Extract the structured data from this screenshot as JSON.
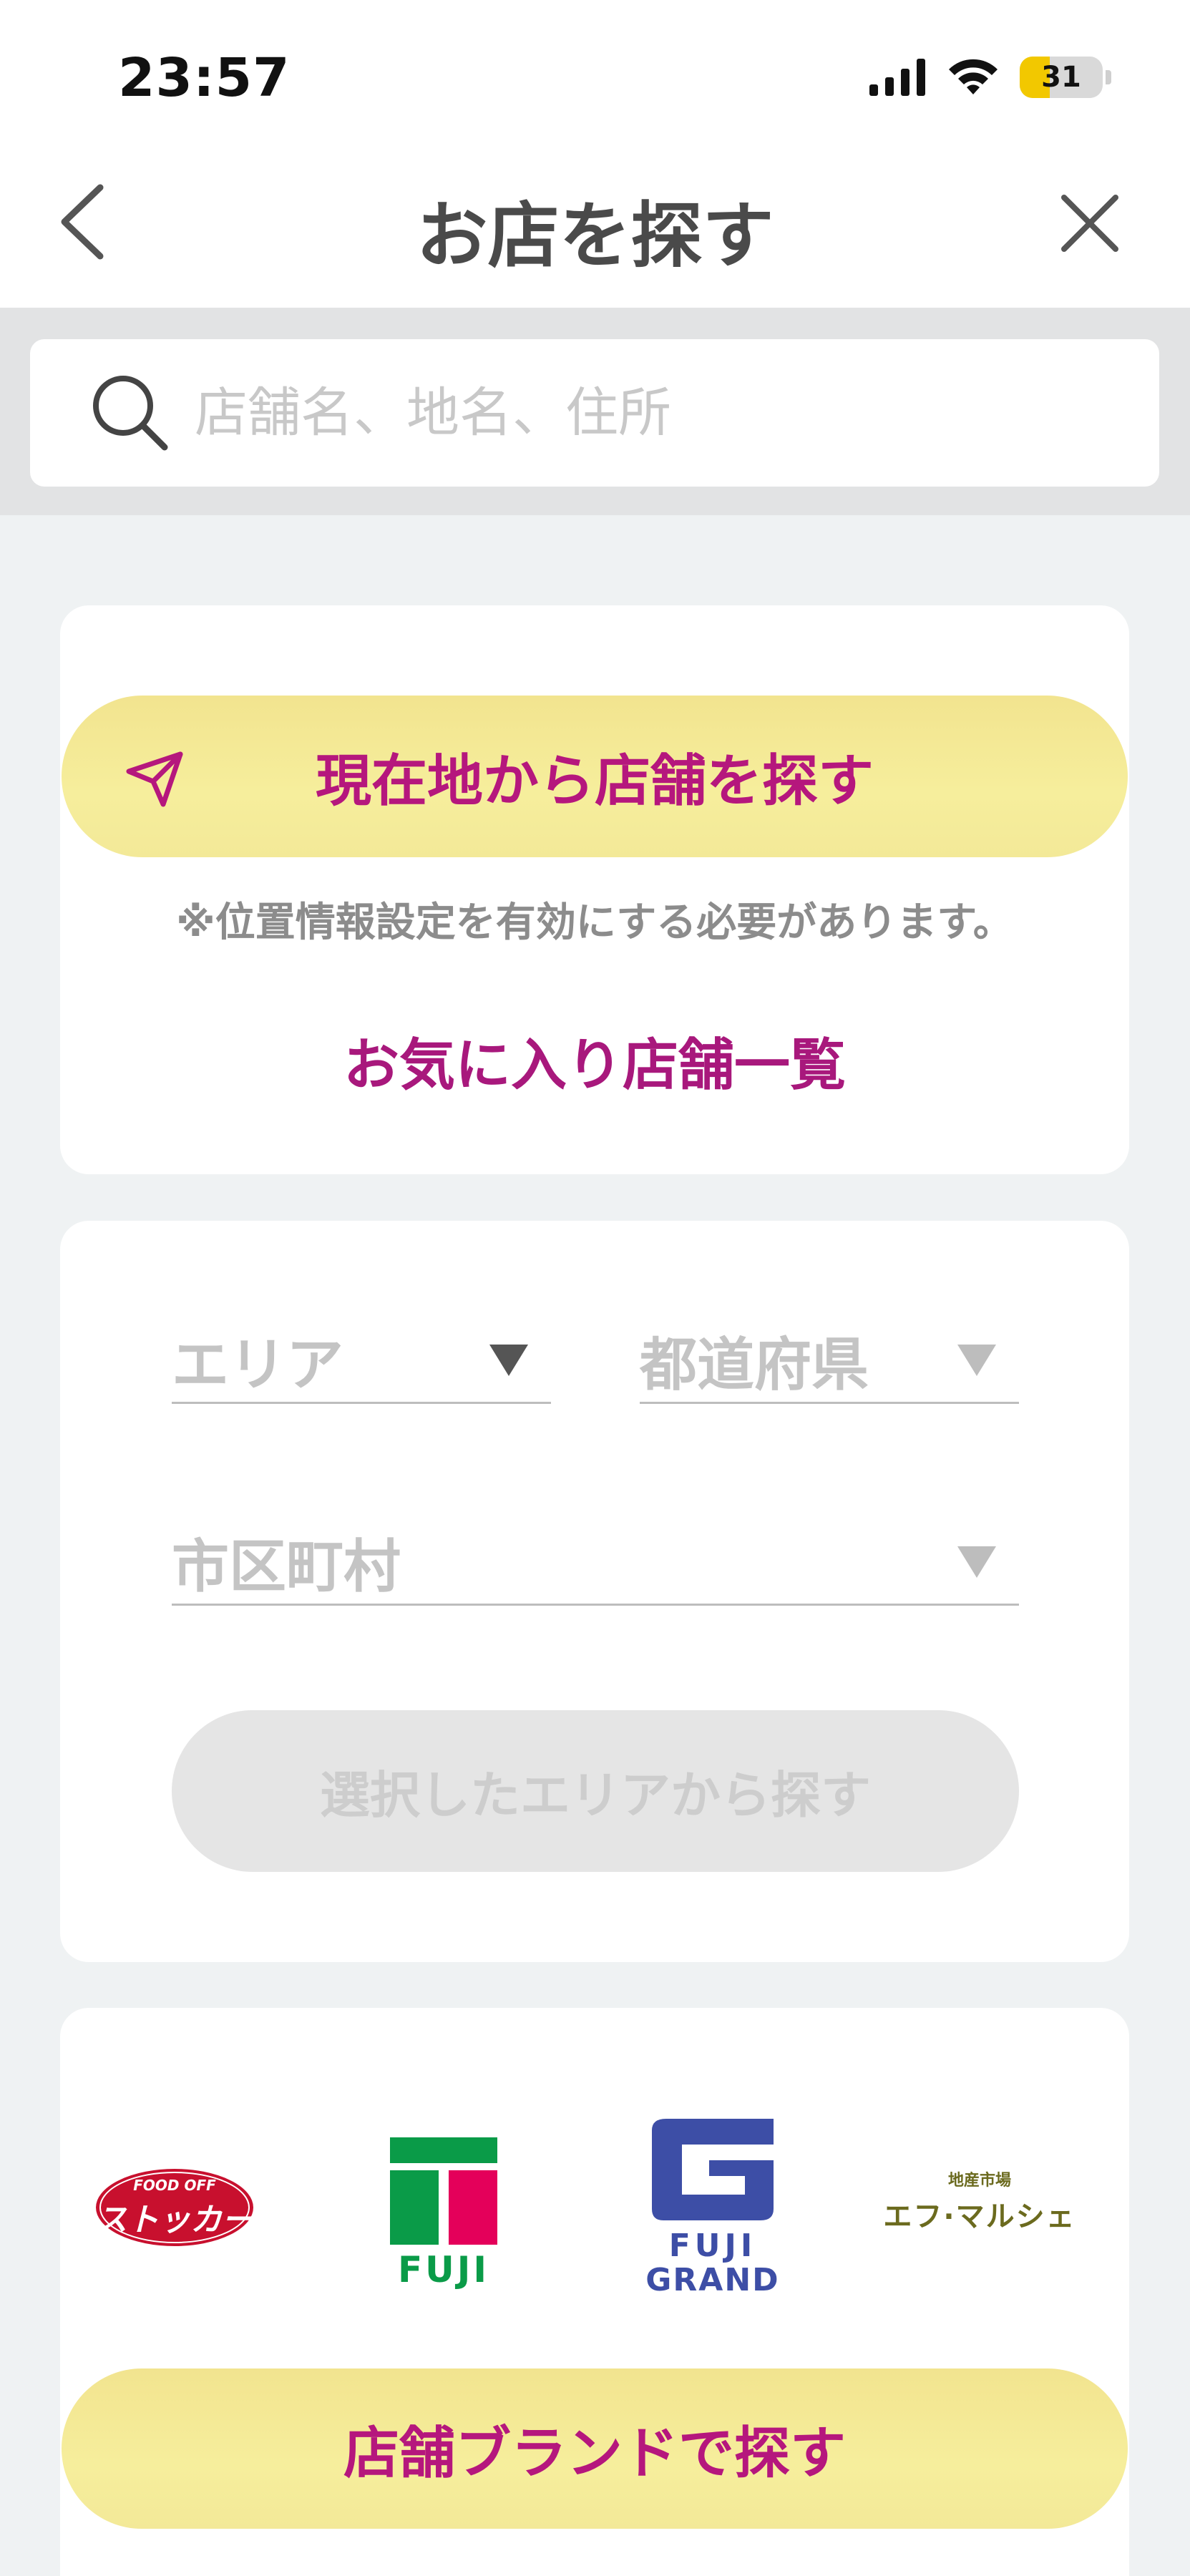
{
  "status_bar": {
    "time": "23:57",
    "battery": "31",
    "icons": [
      "cellular-signal-icon",
      "wifi-icon",
      "battery-icon"
    ]
  },
  "nav": {
    "title": "お店を探す",
    "back_icon": "chevron-left-icon",
    "close_icon": "close-icon"
  },
  "search": {
    "placeholder": "店舗名、地名、住所",
    "value": ""
  },
  "location_card": {
    "button_label": "現在地から店舗を探す",
    "note": "※位置情報設定を有効にする必要があります。",
    "favorites_label": "お気に入り店舗一覧"
  },
  "area_card": {
    "area_label": "エリア",
    "prefecture_label": "都道府県",
    "city_label": "市区町村",
    "search_button_label": "選択したエリアから探す"
  },
  "brand_card": {
    "brands": [
      {
        "name": "stocker",
        "small_text": "FOOD OFF",
        "logo_text": "ストッカー"
      },
      {
        "name": "fuji",
        "logo_text": "FUJI"
      },
      {
        "name": "fuji-grand",
        "logo_text_1": "FUJI",
        "logo_text_2": "GRAND"
      },
      {
        "name": "f-marche",
        "small_text": "地産市場",
        "logo_text": "エフ·マルシェ"
      }
    ],
    "button_label": "店舗ブランドで探す"
  },
  "colors": {
    "accent_text": "#b5177d",
    "button_yellow": "#f4ea97",
    "background": "#eff2f3"
  }
}
